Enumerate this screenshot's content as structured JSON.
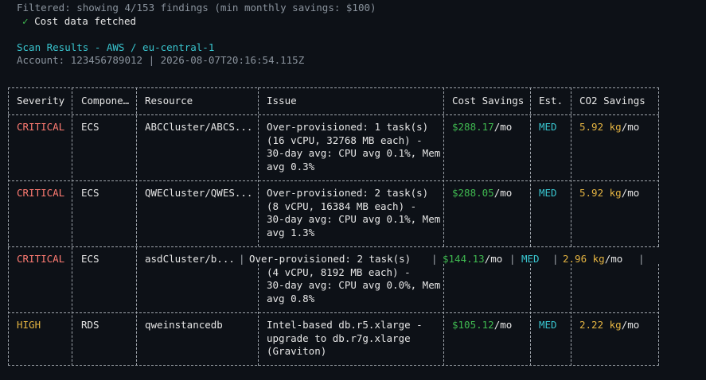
{
  "header": {
    "filter_line": "Filtered: showing 4/153 findings (min monthly savings: $100)",
    "cost_check": "✓",
    "cost_status": "Cost data fetched",
    "scan_title": "Scan Results - AWS / eu-central-1",
    "account_line": "Account: 123456789012 | 2026-08-07T20:16:54.115Z"
  },
  "table": {
    "columns": [
      "Severity",
      "Compone…",
      "Resource",
      "Issue",
      "Cost Savings",
      "Est.",
      "CO2 Savings"
    ],
    "rows": [
      {
        "severity": "CRITICAL",
        "component": "ECS",
        "resource": "ABCCluster/ABCS...",
        "issue_lines": [
          "Over-provisioned: 1 task(s)",
          "(16 vCPU, 32768 MB each) -",
          "30-day avg: CPU avg 0.1%, Mem",
          "avg 0.3%"
        ],
        "cost_value": "$288.17",
        "cost_unit": "/mo",
        "est": "MED",
        "co2_value": "5.92 kg",
        "co2_unit": "/mo"
      },
      {
        "severity": "CRITICAL",
        "component": "ECS",
        "resource": "QWECluster/QWES...",
        "issue_lines": [
          "Over-provisioned: 2 task(s)",
          "(8 vCPU, 16384 MB each) -",
          "30-day avg: CPU avg 0.1%, Mem",
          "avg 1.3%"
        ],
        "cost_value": "$288.05",
        "cost_unit": "/mo",
        "est": "MED",
        "co2_value": "5.92 kg",
        "co2_unit": "/mo"
      },
      {
        "severity": "CRITICAL",
        "component": "ECS",
        "resource": "asdCluster/b...",
        "issue_lines": [
          "Over-provisioned: 2 task(s)",
          "(4 vCPU, 8192 MB each) -",
          "30-day avg: CPU avg 0.0%, Mem",
          "avg 0.8%"
        ],
        "cost_value": "$144.13",
        "cost_unit": "/mo",
        "est": "MED",
        "co2_value": "2.96 kg",
        "co2_unit": "/mo"
      },
      {
        "severity": "HIGH",
        "component": "RDS",
        "resource": "qweinstancedb",
        "issue_lines": [
          "Intel-based db.r5.xlarge -",
          "upgrade to db.r7g.xlarge",
          "(Graviton)"
        ],
        "cost_value": "$105.12",
        "cost_unit": "/mo",
        "est": "MED",
        "co2_value": "2.22 kg",
        "co2_unit": "/mo"
      }
    ]
  },
  "colors": {
    "background": "#0d1117",
    "critical": "#ff7b72",
    "high": "#e3b341",
    "cost": "#3fb950",
    "est": "#39c5cf",
    "co2": "#e3b341",
    "title": "#39c5cf",
    "dim": "#8b949e"
  }
}
